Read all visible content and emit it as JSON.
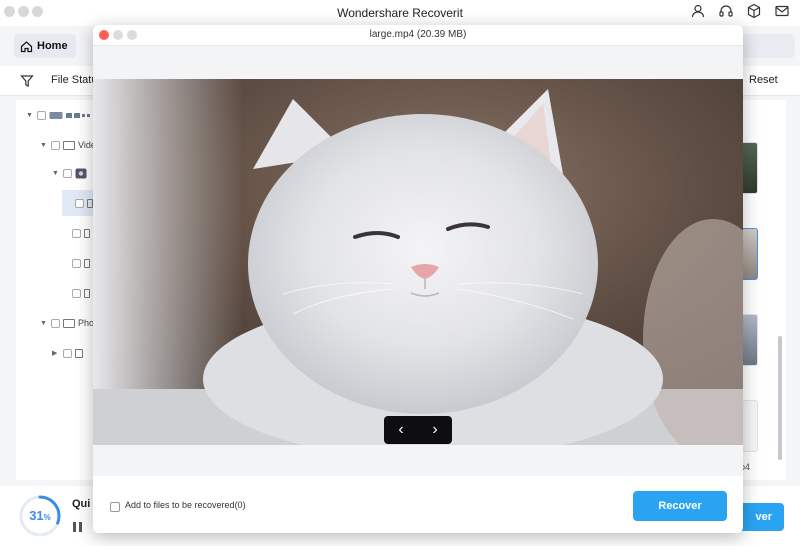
{
  "app": {
    "title": "Wondershare Recoverit",
    "icons": [
      "user-icon",
      "headset-icon",
      "cube-icon",
      "mail-icon"
    ]
  },
  "nav": {
    "home_label": "Home"
  },
  "filter": {
    "file_status_label": "File Statu",
    "reset_label": "Reset"
  },
  "tree": {
    "items": [
      {
        "label": ""
      },
      {
        "label": "Vide"
      },
      {
        "label": ""
      },
      {
        "label": ""
      },
      {
        "label": ""
      },
      {
        "label": ""
      },
      {
        "label": ""
      },
      {
        "label": "Pho"
      },
      {
        "label": ""
      }
    ]
  },
  "thumbnails": {
    "partial_label": "p4"
  },
  "progress": {
    "percent": 31,
    "percent_value": "31",
    "percent_sign": "%",
    "status_label": "Qui"
  },
  "main_recover_label": "ver",
  "preview": {
    "title": "large.mp4 (20.39 MB)",
    "prev_label": "‹",
    "next_label": "›",
    "add_label": "Add to files to be recovered(0)",
    "recover_label": "Recover"
  },
  "colors": {
    "accent": "#2aa4f2",
    "progress": "#3a8ee6",
    "close": "#ff5f57"
  }
}
